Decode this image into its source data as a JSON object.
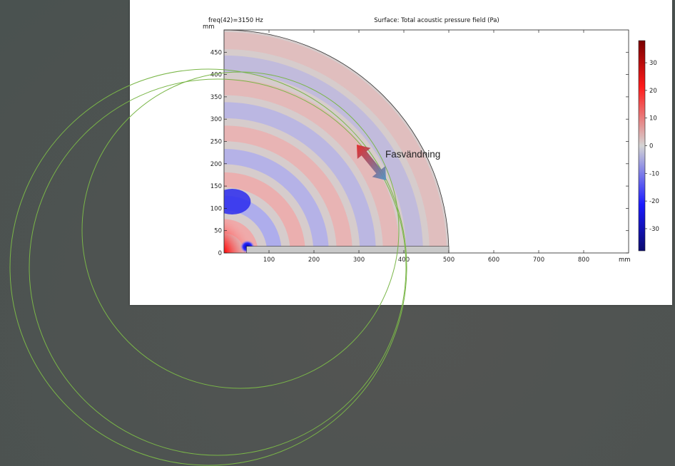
{
  "chart_data": {
    "type": "heatmap",
    "title": "Surface: Total acoustic pressure field (Pa)",
    "subtitle": "freq(42)=3150 Hz",
    "x_unit": "mm",
    "y_unit": "mm",
    "xlim": [
      0,
      900
    ],
    "ylim": [
      0,
      500
    ],
    "x_ticks": [
      "100",
      "200",
      "300",
      "400",
      "500",
      "600",
      "700",
      "800"
    ],
    "y_ticks": [
      "0",
      "50",
      "100",
      "150",
      "200",
      "250",
      "300",
      "350",
      "400",
      "450"
    ],
    "domain": {
      "shape": "quarter-circle",
      "radius": 500
    },
    "colorbar": {
      "range": [
        -38,
        38
      ],
      "ticks": [
        "30",
        "20",
        "10",
        "0",
        "-10",
        "-20",
        "-30"
      ],
      "colors": [
        "#0a0a6e",
        "#1a1aff",
        "#d4d4d4",
        "#ff1a1a",
        "#7a0000"
      ]
    },
    "annotation": {
      "text": "Fasvändning",
      "arrow_colors": [
        "#e02020",
        "#4a90c8"
      ]
    },
    "overlay": {
      "type": "circles",
      "color": "#7ab648",
      "count": 3
    }
  }
}
